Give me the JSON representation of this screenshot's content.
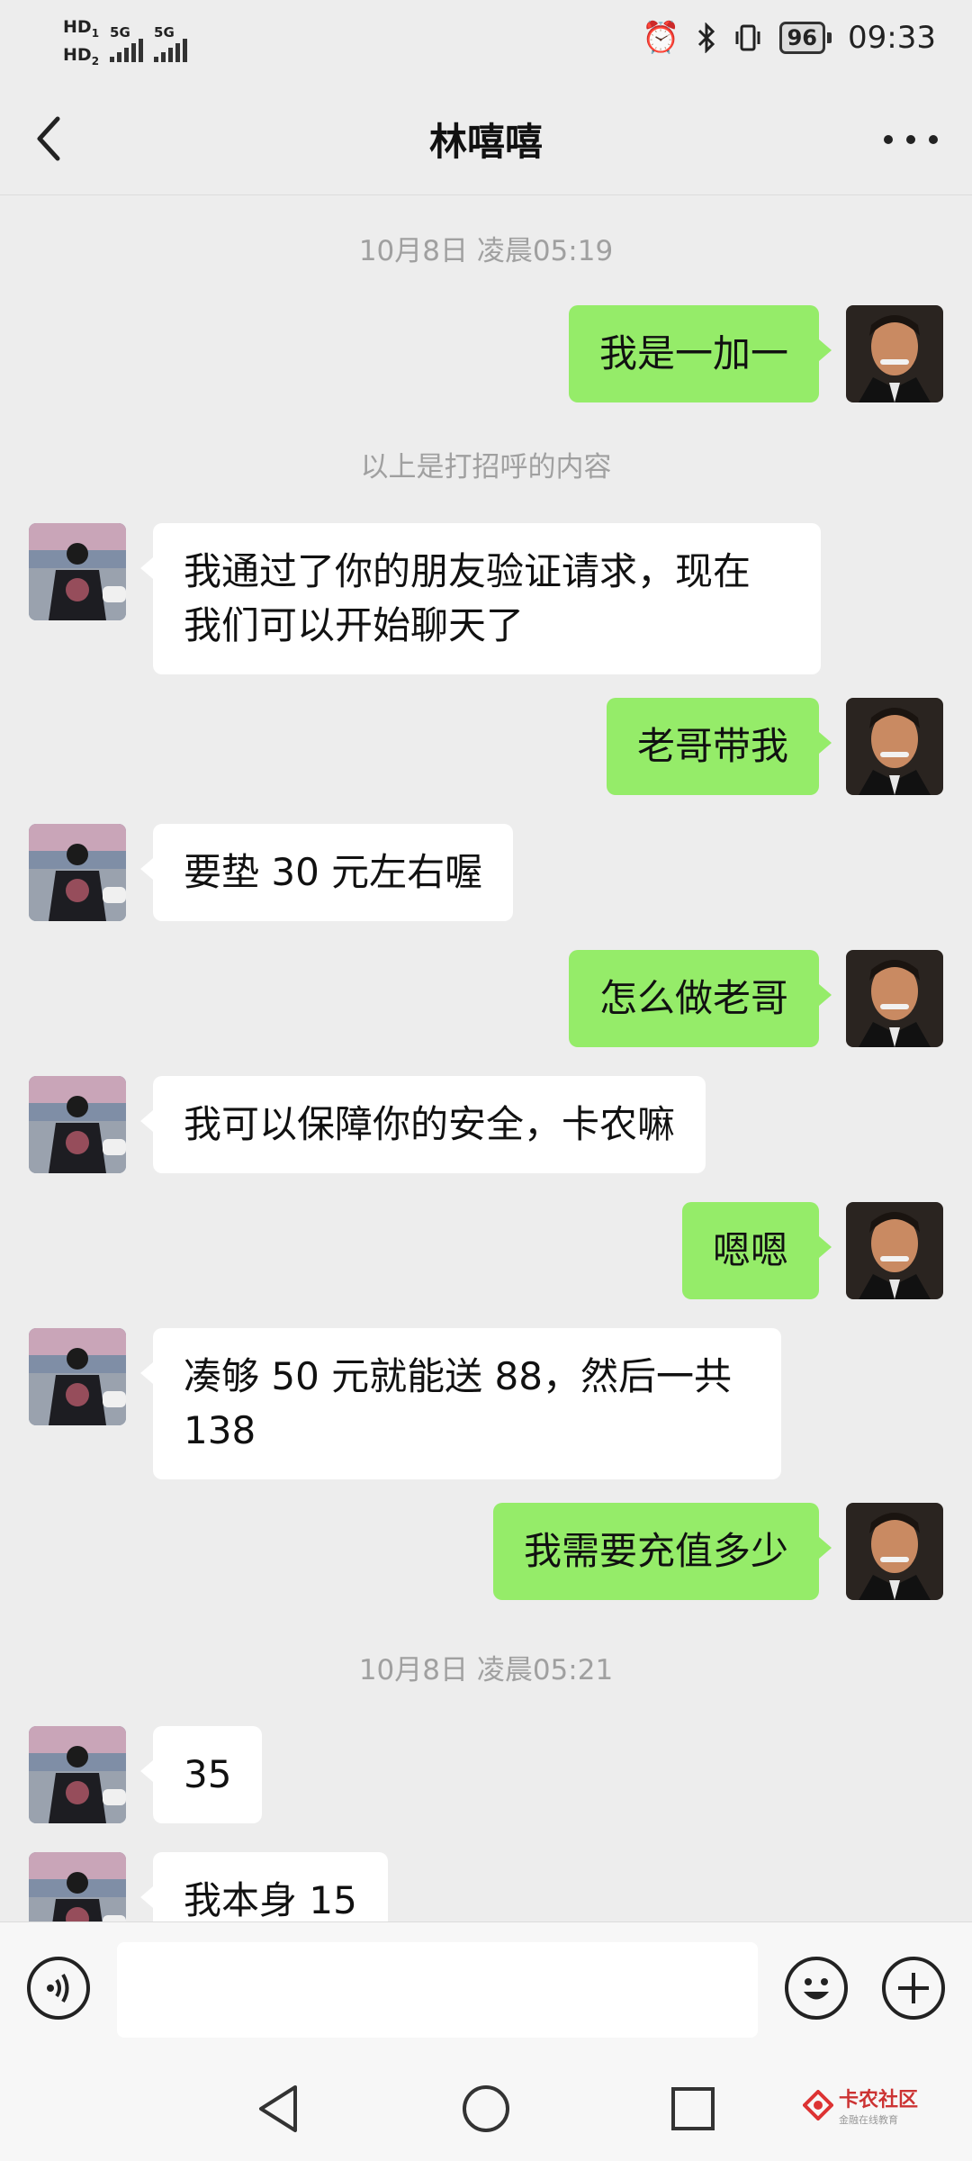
{
  "status_bar": {
    "hd1": "HD",
    "hd1_sub": "1",
    "hd2": "HD",
    "hd2_sub": "2",
    "net1": "5G",
    "net2": "5G",
    "battery": "96",
    "time": "09:33"
  },
  "header": {
    "title": "林嘻嘻"
  },
  "chat": {
    "timestamp1": "10月8日 凌晨05:19",
    "system_note": "以上是打招呼的内容",
    "timestamp2": "10月8日 凌晨05:21",
    "messages": [
      {
        "side": "out",
        "text": "我是一加一"
      },
      {
        "side": "in",
        "text": "我通过了你的朋友验证请求，现在\n我们可以开始聊天了"
      },
      {
        "side": "out",
        "text": "老哥带我"
      },
      {
        "side": "in",
        "text": "要垫 30 元左右喔"
      },
      {
        "side": "out",
        "text": "怎么做老哥"
      },
      {
        "side": "in",
        "text": "我可以保障你的安全，卡农嘛"
      },
      {
        "side": "out",
        "text": "嗯嗯"
      },
      {
        "side": "in",
        "text": "凑够 50 元就能送 88，然后一共\n138"
      },
      {
        "side": "out",
        "text": "我需要充值多少"
      },
      {
        "side": "in",
        "text": "35"
      },
      {
        "side": "in",
        "text": "我本身 15"
      }
    ]
  },
  "watermark": {
    "name": "卡农社区",
    "sub": "金融在线教育"
  },
  "colors": {
    "background": "#ededed",
    "outgoing_bubble": "#95ec69",
    "incoming_bubble": "#ffffff"
  },
  "icons": {
    "back": "chevron-left-icon",
    "more": "more-dots-icon",
    "voice": "voice-icon",
    "emoji": "emoji-icon",
    "add": "plus-icon"
  }
}
